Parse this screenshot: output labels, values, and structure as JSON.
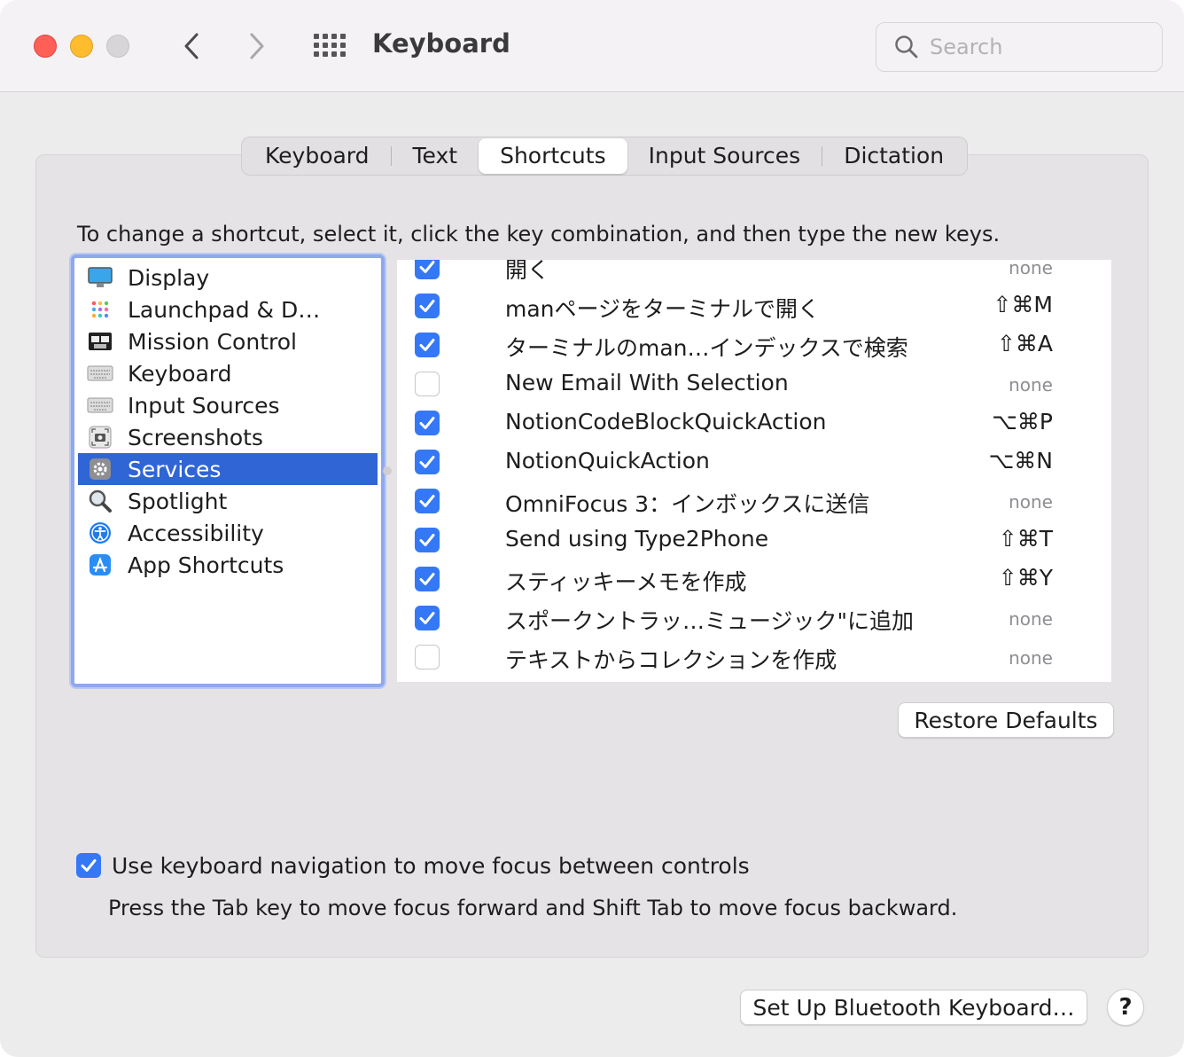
{
  "window": {
    "title": "Keyboard",
    "search_placeholder": "Search"
  },
  "tabs": [
    {
      "label": "Keyboard",
      "active": false
    },
    {
      "label": "Text",
      "active": false
    },
    {
      "label": "Shortcuts",
      "active": true
    },
    {
      "label": "Input Sources",
      "active": false
    },
    {
      "label": "Dictation",
      "active": false
    }
  ],
  "instructions": "To change a shortcut, select it, click the key combination, and then type the new keys.",
  "categories": [
    {
      "label": "Display",
      "icon": "display-icon"
    },
    {
      "label": "Launchpad & D…",
      "icon": "launchpad-icon"
    },
    {
      "label": "Mission Control",
      "icon": "mission-control-icon"
    },
    {
      "label": "Keyboard",
      "icon": "keyboard-icon"
    },
    {
      "label": "Input Sources",
      "icon": "keyboard-icon"
    },
    {
      "label": "Screenshots",
      "icon": "screenshot-icon"
    },
    {
      "label": "Services",
      "icon": "gear-icon",
      "selected": true
    },
    {
      "label": "Spotlight",
      "icon": "magnifier-icon"
    },
    {
      "label": "Accessibility",
      "icon": "accessibility-icon"
    },
    {
      "label": "App Shortcuts",
      "icon": "app-store-icon"
    }
  ],
  "services": [
    {
      "name": "開く",
      "checked": true,
      "shortcut": "none"
    },
    {
      "name": "manページをターミナルで開く",
      "checked": true,
      "shortcut": "⇧⌘M"
    },
    {
      "name": "ターミナルのman…インデックスで検索",
      "checked": true,
      "shortcut": "⇧⌘A"
    },
    {
      "name": "New Email With Selection",
      "checked": false,
      "shortcut": "none"
    },
    {
      "name": "NotionCodeBlockQuickAction",
      "checked": true,
      "shortcut": "⌥⌘P"
    },
    {
      "name": "NotionQuickAction",
      "checked": true,
      "shortcut": "⌥⌘N"
    },
    {
      "name": "OmniFocus 3：インボックスに送信",
      "checked": true,
      "shortcut": "none"
    },
    {
      "name": "Send using Type2Phone",
      "checked": true,
      "shortcut": "⇧⌘T"
    },
    {
      "name": "スティッキーメモを作成",
      "checked": true,
      "shortcut": "⇧⌘Y"
    },
    {
      "name": "スポークントラッ…ミュージック\"に追加",
      "checked": true,
      "shortcut": "none"
    },
    {
      "name": "テキストからコレクションを作成",
      "checked": false,
      "shortcut": "none"
    }
  ],
  "buttons": {
    "restore_defaults": "Restore Defaults",
    "bluetooth_setup": "Set Up Bluetooth Keyboard…",
    "help": "?"
  },
  "keyboard_navigation": {
    "checked": true,
    "label": "Use keyboard navigation to move focus between controls",
    "hint": "Press the Tab key to move focus forward and Shift Tab to move focus backward."
  },
  "colors": {
    "accent": "#3478f6",
    "selection": "#2f65d4",
    "close": "#ff5f57",
    "minimize": "#febc2e"
  }
}
